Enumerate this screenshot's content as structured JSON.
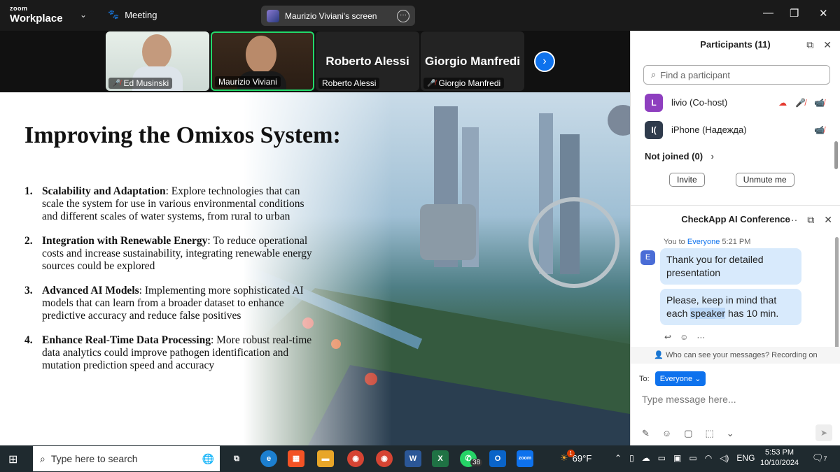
{
  "app": {
    "logo_line1": "zoom",
    "logo_line2": "Workplace",
    "meeting_label": "Meeting",
    "screen_share_label": "Maurizio Viviani's screen"
  },
  "video_tiles": [
    {
      "name": "Ed Musinski",
      "muted": true
    },
    {
      "name": "Maurizio Viviani",
      "muted": false
    },
    {
      "name": "Roberto Alessi",
      "display": "Roberto Alessi",
      "muted": false
    },
    {
      "name": "Giorgio Manfredi",
      "display": "Giorgio Manfredi",
      "muted": true
    }
  ],
  "slide": {
    "title": "Improving the Omixos System:",
    "items": [
      {
        "num": "1.",
        "bold": "Scalability and Adaptation",
        "text": ": Explore technologies that can scale the system for use in various environmental conditions and different scales of water systems, from rural to urban"
      },
      {
        "num": "2.",
        "bold": "Integration with Renewable Energy",
        "text": ": To reduce operational costs and increase sustainability, integrating renewable energy sources could be explored"
      },
      {
        "num": "3.",
        "bold": "Advanced AI Models",
        "text": ": Implementing more sophisticated AI models that can learn from a broader dataset to enhance predictive accuracy and reduce false positives"
      },
      {
        "num": "4.",
        "bold": "Enhance Real-Time Data Processing",
        "text": ": More robust real-time data analytics could improve pathogen identification and mutation prediction speed and accuracy"
      }
    ]
  },
  "participants": {
    "title": "Participants (11)",
    "search_placeholder": "Find a participant",
    "list": [
      {
        "initial": "L",
        "name": "livio (Co-host)",
        "color": "#8e3fbf"
      },
      {
        "initial": "I(",
        "name": "iPhone (Надежда)",
        "color": "#2f3b4c"
      }
    ],
    "not_joined": "Not joined (0)",
    "invite_label": "Invite",
    "unmute_label": "Unmute me"
  },
  "chat": {
    "title": "CheckApp AI Conference",
    "meta_you": "You to",
    "meta_to": "Everyone",
    "meta_time": "5:21 PM",
    "sender_initial": "E",
    "msg1": "Thank you for detailed presentation",
    "msg2_pre": "Please, keep in mind that each",
    "msg2_hl": "speaker",
    "msg2_post": "has 10 min.",
    "privacy": "Who can see your messages? Recording on",
    "to_label": "To:",
    "to_value": "Everyone",
    "input_placeholder": "Type message here..."
  },
  "taskbar": {
    "search_placeholder": "Type here to search",
    "whatsapp_badge": "38",
    "weather": "69°F",
    "weather_badge": "1",
    "lang": "ENG",
    "time": "5:53 PM",
    "date": "10/10/2024",
    "notif_count": "7"
  }
}
